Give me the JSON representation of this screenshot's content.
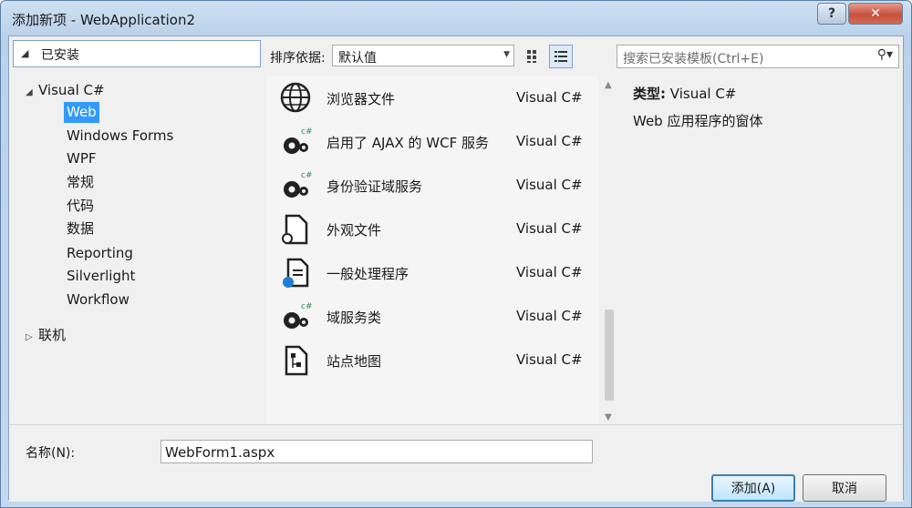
{
  "window": {
    "title": "添加新项 - WebApplication2",
    "help_label": "?",
    "close_label": "✕"
  },
  "tree": {
    "installed_label": "已安装",
    "root_label": "Visual C#",
    "children": [
      "Web",
      "Windows Forms",
      "WPF",
      "常规",
      "代码",
      "数据",
      "Reporting",
      "Silverlight",
      "Workflow"
    ],
    "selected": "Web",
    "online_label": "联机"
  },
  "toolbar": {
    "sort_label": "排序依据:",
    "sort_value": "默认值",
    "search_placeholder": "搜索已安装模板(Ctrl+E)"
  },
  "items": [
    {
      "name": "浏览器文件",
      "lang": "Visual C#",
      "icon": "globe-icon"
    },
    {
      "name": "启用了 AJAX 的 WCF 服务",
      "lang": "Visual C#",
      "icon": "gear-cs-icon"
    },
    {
      "name": "身份验证域服务",
      "lang": "Visual C#",
      "icon": "gear-cs-icon"
    },
    {
      "name": "外观文件",
      "lang": "Visual C#",
      "icon": "skin-file-icon"
    },
    {
      "name": "一般处理程序",
      "lang": "Visual C#",
      "icon": "handler-icon"
    },
    {
      "name": "域服务类",
      "lang": "Visual C#",
      "icon": "gear-cs-icon"
    },
    {
      "name": "站点地图",
      "lang": "Visual C#",
      "icon": "sitemap-icon"
    }
  ],
  "detail": {
    "type_label": "类型:",
    "type_value": "Visual C#",
    "description": "Web 应用程序的窗体"
  },
  "bottom": {
    "name_label": "名称(N):",
    "name_value": "WebForm1.aspx",
    "add_label": "添加(A)",
    "cancel_label": "取消"
  },
  "colors": {
    "selection": "#3399ff",
    "accent": "#3c7fb1"
  }
}
